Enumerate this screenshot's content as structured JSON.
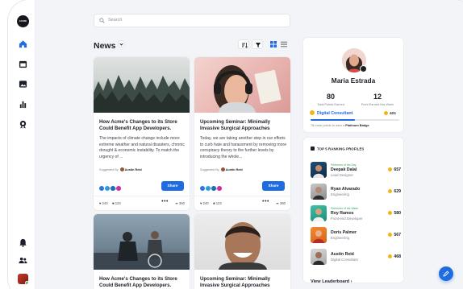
{
  "brand": {
    "logo": "ACME"
  },
  "search": {
    "placeholder": "Search"
  },
  "page": {
    "title": "News"
  },
  "colors": {
    "accent": "#1f6be0",
    "gold": "#f4b417",
    "green": "#2aa85a"
  },
  "nav_icons": [
    "home-icon",
    "calendar-icon",
    "image-icon",
    "chart-icon",
    "award-icon",
    "bell-icon",
    "users-icon"
  ],
  "cards": [
    {
      "title": "How Acme's Changes to its Store Could Benefit App Developers.",
      "body": "The impacts of climate change include more extreme weather and natural disasters, chronic drought & economic instability. To match the urgency of ...",
      "suggested_label": "Suggested By",
      "author": "Austin Reid",
      "share_status": "Not shared yet",
      "share_label": "Share",
      "likes": "240",
      "comments": "123",
      "shares": "360"
    },
    {
      "title": "Upcoming Seminar: Minimally Invasive Surgical Approaches",
      "body": "Today, we are taking another step in our efforts to curb hate and harassment by removing more conspiracy theory to the further levels by introducing the whole...",
      "suggested_label": "Suggested By",
      "author": "Austin Reid",
      "share_status": "Not shared yet",
      "share_label": "Share",
      "likes": "240",
      "comments": "123",
      "shares": "360"
    },
    {
      "title": "How Acme's Changes to its Store Could Benefit App Developers."
    },
    {
      "title": "Upcoming Seminar: Minimally Invasive Surgical Approaches"
    }
  ],
  "profile": {
    "name": "Maria Estrada",
    "stats": [
      {
        "value": "80",
        "label": "Total Points Earned"
      },
      {
        "value": "12",
        "label": "Point Earned this Week"
      }
    ],
    "level": "Digital Consultant",
    "points": "421",
    "progress": 0.5,
    "hint_prefix": "78 more points to earn a",
    "hint_badge": "Platinum Badge"
  },
  "ranking": {
    "heading": "TOP 5 RANKING PROFILES",
    "items": [
      {
        "tag": "Performer of the Day",
        "name": "Deepak Dalal",
        "role": "Lead Designer",
        "score": "657"
      },
      {
        "tag": "",
        "name": "Ryan Alvarado",
        "role": "Engineering",
        "score": "629"
      },
      {
        "tag": "Performer of the Week",
        "name": "Roy Ramos",
        "role": "Front-end Developer",
        "score": "580"
      },
      {
        "tag": "",
        "name": "Doris Palmer",
        "role": "Engineering",
        "score": "567"
      },
      {
        "tag": "",
        "name": "Austin Reid",
        "role": "Digital Consultant",
        "score": "468"
      }
    ],
    "view_all": "View Leaderboard"
  }
}
